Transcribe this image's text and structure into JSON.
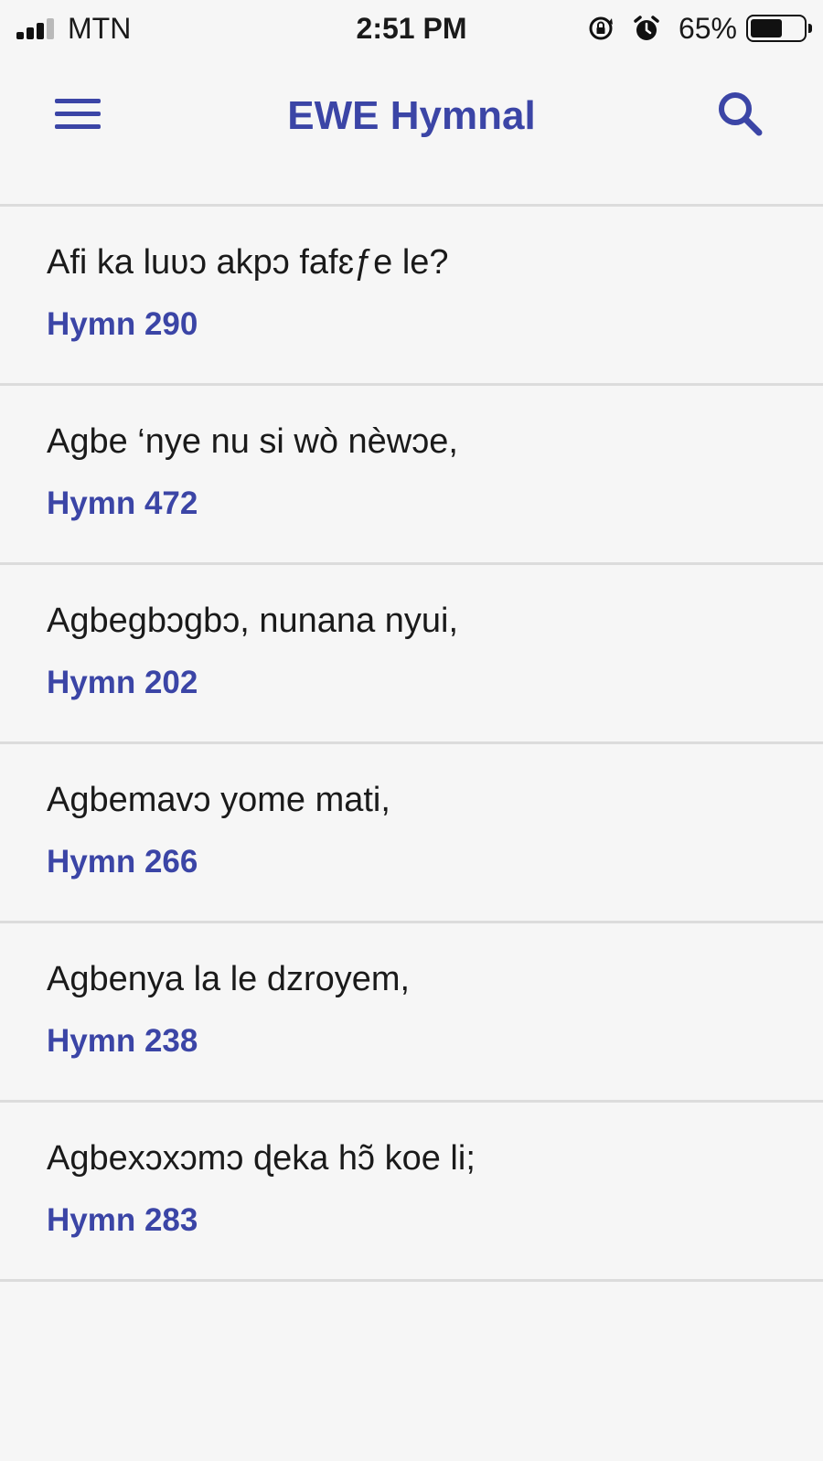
{
  "status_bar": {
    "carrier": "MTN",
    "time": "2:51 PM",
    "battery_percent": "65%",
    "battery_level": 0.65,
    "signal_bars_total": 4,
    "signal_bars_active": 3,
    "icons": [
      "signal-strength-icon",
      "orientation-lock-icon",
      "alarm-icon",
      "battery-icon"
    ]
  },
  "header": {
    "title": "EWE Hymnal",
    "menu_icon": "hamburger-menu-icon",
    "search_icon": "search-icon",
    "accent_color": "#3b45a6"
  },
  "hymns": [
    {
      "title": "Afi ka luʋɔ akpɔ fafɛƒe le?",
      "number": "Hymn 290"
    },
    {
      "title": "Agbe ‘nye nu si wò nèwɔe,",
      "number": "Hymn 472"
    },
    {
      "title": "Agbegbɔgbɔ, nunana nyui,",
      "number": "Hymn 202"
    },
    {
      "title": "Agbemavɔ yome mati,",
      "number": "Hymn 266"
    },
    {
      "title": "Agbenya la le dzroyem,",
      "number": "Hymn 238"
    },
    {
      "title": "Agbexɔxɔmɔ ɖeka hɔ̃ koe li;",
      "number": "Hymn 283"
    }
  ]
}
